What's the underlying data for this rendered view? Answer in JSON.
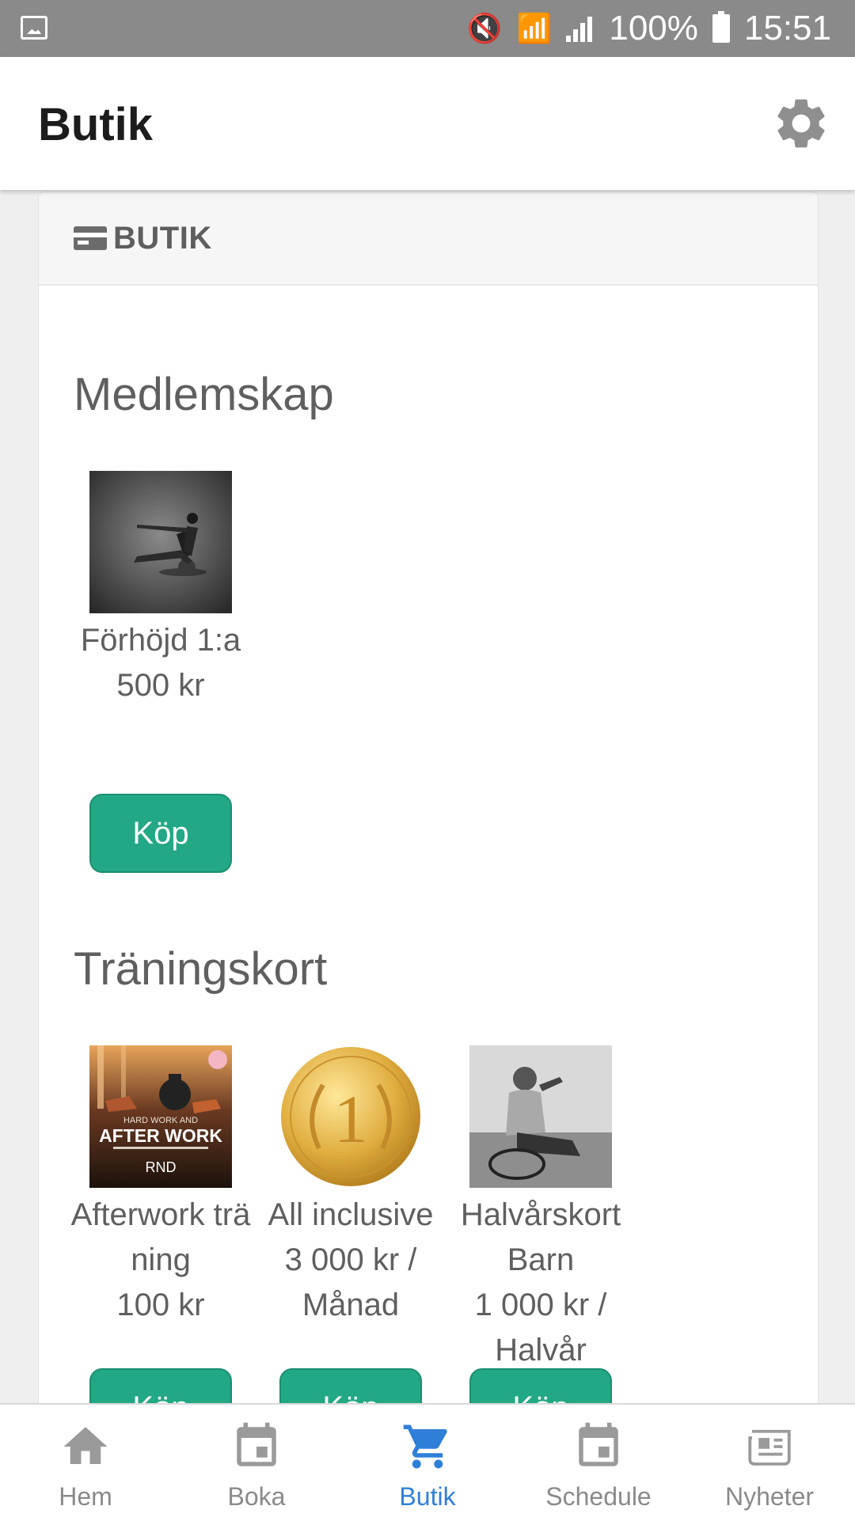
{
  "status_bar": {
    "battery": "100%",
    "time": "15:51"
  },
  "header": {
    "title": "Butik",
    "settings_icon": "gear-icon"
  },
  "card": {
    "title": "BUTIK",
    "icon": "credit-card-icon"
  },
  "sections": [
    {
      "title": "Medlemskap",
      "products": [
        {
          "name": "Förhöjd 1:a",
          "price": "500 kr",
          "button": "Köp",
          "image": "fitness-woman-photo"
        }
      ]
    },
    {
      "title": "Träningskort",
      "products": [
        {
          "name": "Afterwork träning",
          "price": "100 kr",
          "button": "Köp",
          "image": "afterwork-poster",
          "poster_text": "HARD WORK AND AFTER WORK"
        },
        {
          "name": "All inclusive",
          "price": "3 000 kr / Månad",
          "button": "Köp",
          "image": "gold-medal"
        },
        {
          "name": "Halvårskort Barn",
          "price": "1 000 kr / Halvår",
          "button": "Köp",
          "image": "cyclist-photo"
        }
      ]
    }
  ],
  "bottom_nav": [
    {
      "label": "Hem",
      "icon": "home-icon",
      "active": false
    },
    {
      "label": "Boka",
      "icon": "calendar-icon",
      "active": false
    },
    {
      "label": "Butik",
      "icon": "cart-icon",
      "active": true
    },
    {
      "label": "Schedule",
      "icon": "calendar-icon",
      "active": false
    },
    {
      "label": "Nyheter",
      "icon": "newspaper-icon",
      "active": false
    }
  ],
  "colors": {
    "accent_green": "#22a884",
    "active_blue": "#2f7fd8",
    "status_bar": "#8a8a8a"
  }
}
